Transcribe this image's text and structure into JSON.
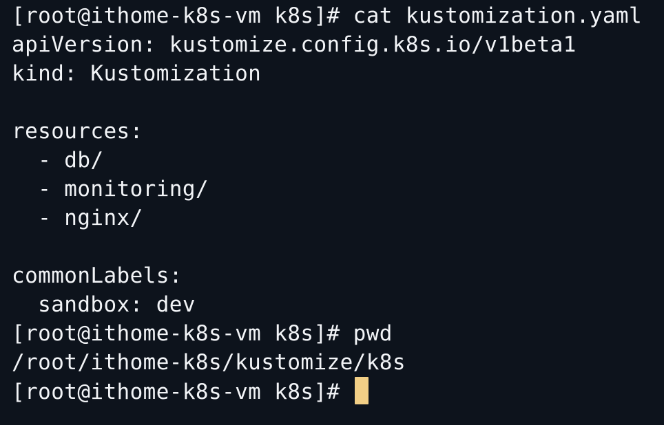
{
  "terminal": {
    "lines": [
      "[root@ithome-k8s-vm k8s]# cat kustomization.yaml",
      "apiVersion: kustomize.config.k8s.io/v1beta1",
      "kind: Kustomization",
      "",
      "resources:",
      "  - db/",
      "  - monitoring/",
      "  - nginx/",
      "",
      "commonLabels:",
      "  sandbox: dev",
      "[root@ithome-k8s-vm k8s]# pwd",
      "/root/ithome-k8s/kustomize/k8s"
    ],
    "prompt": "[root@ithome-k8s-vm k8s]# ",
    "colors": {
      "background": "#0d131c",
      "foreground": "#f2f4f7",
      "cursor": "#f2cf86"
    }
  }
}
